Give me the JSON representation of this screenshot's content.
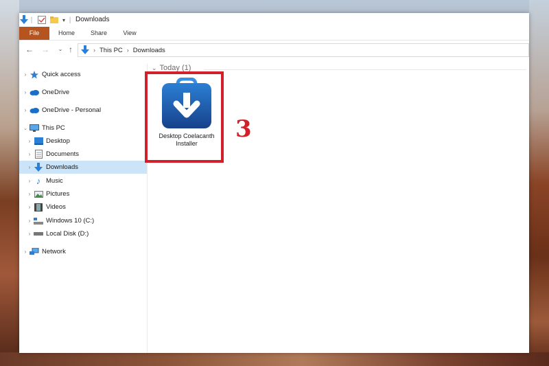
{
  "window": {
    "title": "Downloads"
  },
  "ribbon": {
    "tabs": [
      {
        "label": "File"
      },
      {
        "label": "Home"
      },
      {
        "label": "Share"
      },
      {
        "label": "View"
      }
    ]
  },
  "address_bar": {
    "segments": [
      "This PC",
      "Downloads"
    ]
  },
  "nav_pane": {
    "items": [
      {
        "label": "Quick access",
        "icon": "star-icon"
      },
      {
        "label": "OneDrive",
        "icon": "cloud-icon"
      },
      {
        "label": "OneDrive - Personal",
        "icon": "cloud-icon"
      },
      {
        "label": "This PC",
        "icon": "computer-icon"
      },
      {
        "label": "Desktop",
        "icon": "desktop-icon"
      },
      {
        "label": "Documents",
        "icon": "documents-icon"
      },
      {
        "label": "Downloads",
        "icon": "download-arrow-icon",
        "selected": true
      },
      {
        "label": "Music",
        "icon": "music-note-icon"
      },
      {
        "label": "Pictures",
        "icon": "pictures-icon"
      },
      {
        "label": "Videos",
        "icon": "film-icon"
      },
      {
        "label": "Windows 10 (C:)",
        "icon": "drive-icon"
      },
      {
        "label": "Local Disk (D:)",
        "icon": "drive-icon"
      },
      {
        "label": "Network",
        "icon": "network-icon"
      }
    ]
  },
  "content": {
    "group_header": "Today (1)",
    "files": [
      {
        "label": "Desktop Coelacanth Installer",
        "icon": "installer-download-icon"
      }
    ]
  },
  "annotation": {
    "step_number": "3",
    "color": "#d0202a"
  },
  "colors": {
    "file_tab": "#b5541e",
    "selection": "#cce4f7",
    "installer_blue": "#1e5aa8"
  }
}
